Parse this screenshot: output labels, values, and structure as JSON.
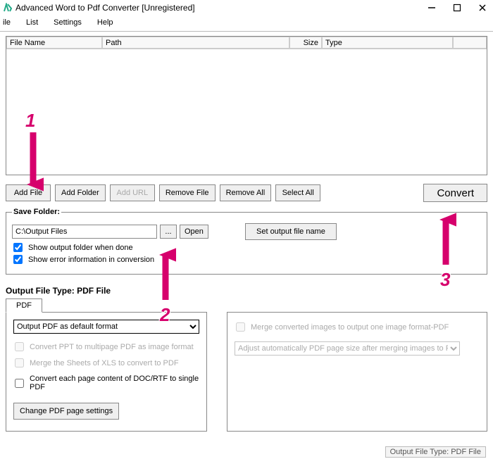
{
  "window": {
    "title": "Advanced Word to Pdf Converter [Unregistered]"
  },
  "menubar": {
    "file": "ile",
    "list": "List",
    "settings": "Settings",
    "help": "Help"
  },
  "list_columns": {
    "filename": "File Name",
    "path": "Path",
    "size": "Size",
    "type": "Type"
  },
  "toolbar": {
    "add_file": "Add File",
    "add_folder": "Add Folder",
    "add_url": "Add URL",
    "remove_file": "Remove File",
    "remove_all": "Remove All",
    "select_all": "Select All",
    "convert": "Convert"
  },
  "save_folder": {
    "legend": "Save Folder:",
    "path_value": "C:\\Output Files",
    "browse": "...",
    "open": "Open",
    "set_output_name": "Set output file name",
    "show_output_folder": "Show output folder when done",
    "show_error_info": "Show error information in conversion"
  },
  "output_type": {
    "label": "Output File Type:  PDF File",
    "tab_pdf": "PDF",
    "format_select": "Output PDF as default format",
    "convert_ppt": "Convert PPT to multipage PDF as image format",
    "merge_xls": "Merge the Sheets of XLS to convert to PDF",
    "each_page": "Convert each page content of DOC/RTF to single PDF",
    "page_settings_btn": "Change PDF page settings",
    "merge_images": "Merge converted images to output one image format-PDF",
    "adjust_size": "Adjust automatically PDF page size after merging images to PDF"
  },
  "status": {
    "text": "Output File Type:  PDF File"
  },
  "annotations": {
    "n1": "1",
    "n2": "2",
    "n3": "3"
  }
}
